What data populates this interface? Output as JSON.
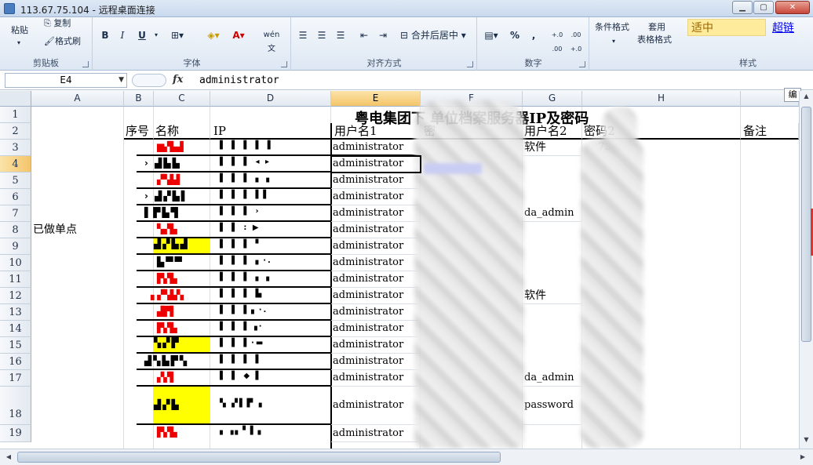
{
  "window": {
    "title": "113.67.75.104 - 远程桌面连接"
  },
  "ribbon": {
    "clipboard": {
      "label": "剪贴板",
      "paste": "粘贴",
      "copy": "复制",
      "format_painter": "格式刷"
    },
    "font": {
      "label": "字体",
      "bold": "B",
      "italic": "I",
      "underline": "U",
      "ab": "A",
      "wen": "wén 文"
    },
    "alignment": {
      "label": "对齐方式",
      "merge": "合并后居中"
    },
    "number": {
      "label": "数字",
      "percent": "%",
      "comma": ",",
      "inc_decimal": "+.0 .00",
      "dec_decimal": ".00 +.0"
    },
    "styles": {
      "label": "样式",
      "cond_format": "条件格式",
      "table_format_1": "套用",
      "table_format_2": "表格格式",
      "good_style": "适中",
      "hyperlink_style": "超链"
    }
  },
  "formula_bar": {
    "name_box": "E4",
    "fx": "fx",
    "value": "administrator"
  },
  "sheet": {
    "columns": [
      "A",
      "B",
      "C",
      "D",
      "E",
      "F",
      "G",
      "H"
    ],
    "selected_column": "E",
    "rows": [
      "1",
      "2",
      "3",
      "4",
      "5",
      "6",
      "7",
      "8",
      "9",
      "10",
      "11",
      "12",
      "13",
      "14",
      "15",
      "16",
      "17",
      "18",
      "19"
    ],
    "selected_row": "4",
    "title": "粤电集团下  单位档案服务器IP及密码",
    "headers": {
      "seq": "序号",
      "name": "名称",
      "ip": "IP",
      "user1": "用户名1",
      "pwd1": "密",
      "user2": "用户名2",
      "pwd2": "密码2",
      "remark": "备注"
    },
    "a8_label": "已做单点",
    "user1_values": [
      "administrator",
      "administrator",
      "administrator",
      "administrator",
      "administrator",
      "administrator",
      "administrator",
      "administrator",
      "administrator",
      "administrator",
      "administrator",
      "administrator",
      "administrator",
      "administrator",
      "administrator",
      "administrator",
      "administrator"
    ],
    "user2_values": {
      "r3": "软件",
      "r7": "da_admin",
      "r12": "软件",
      "r17": "da_admin",
      "r18": "password"
    },
    "pwd2_r3": "72",
    "edit_tab": "编"
  }
}
